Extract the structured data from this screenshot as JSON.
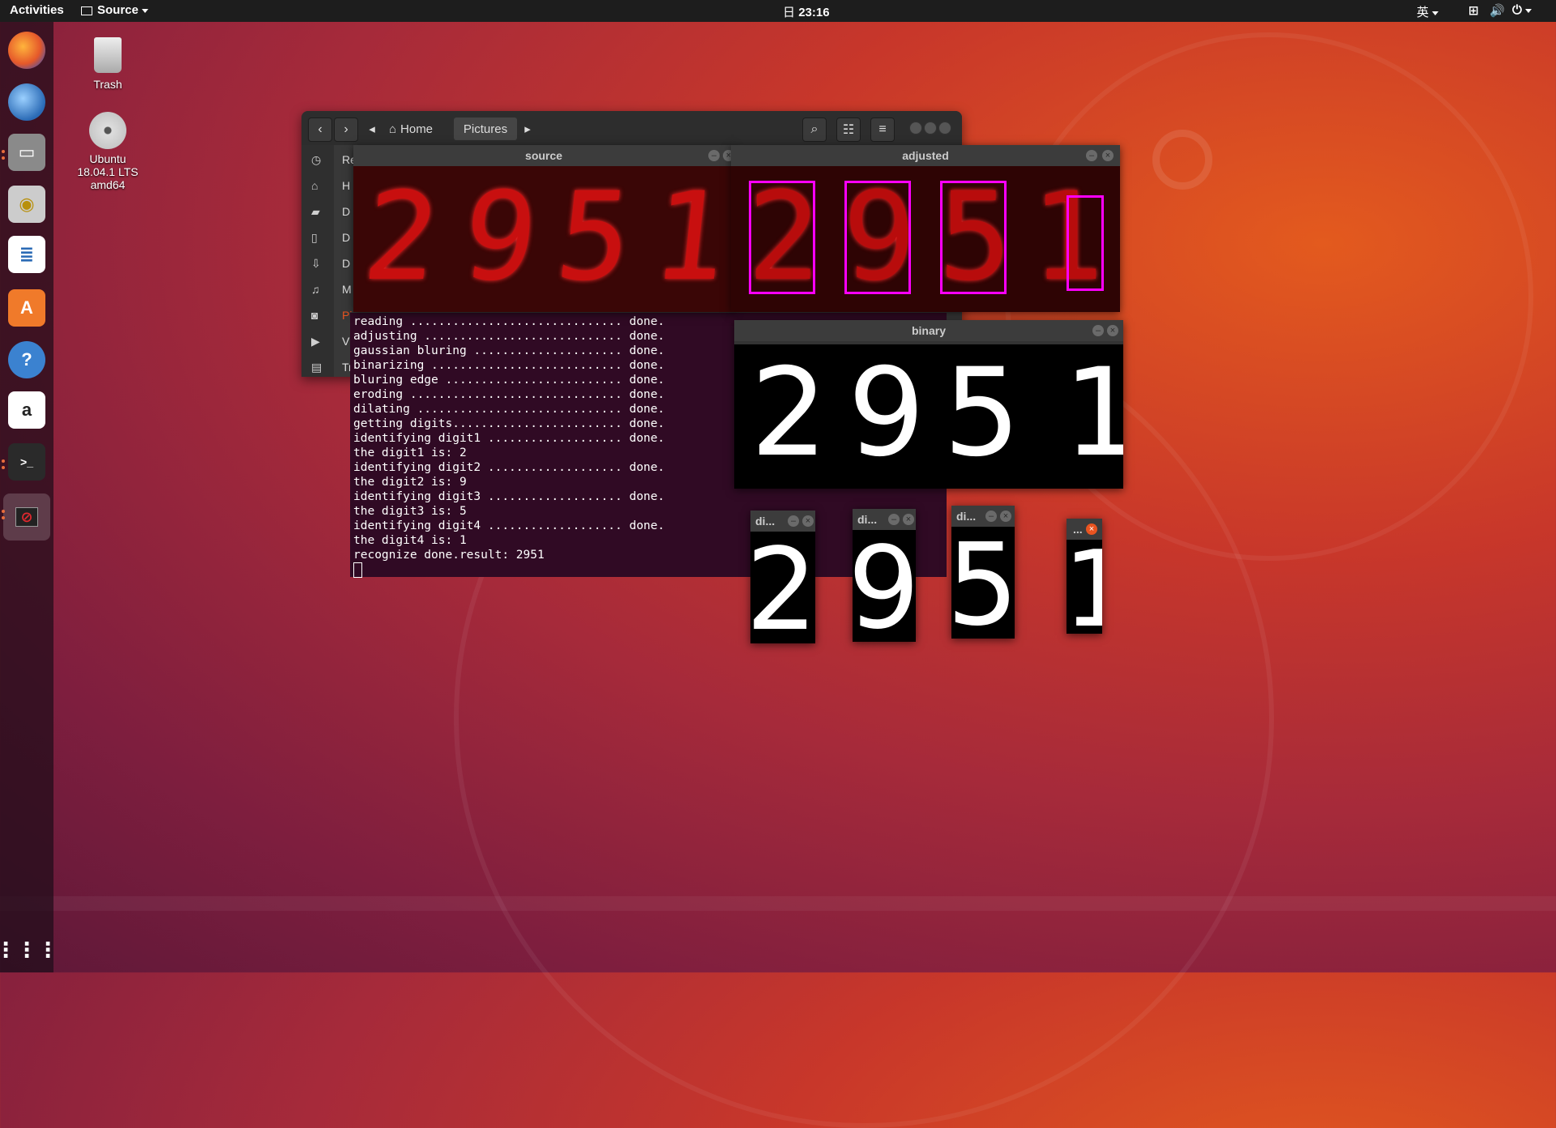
{
  "topbar": {
    "activities": "Activities",
    "app_menu": "Source",
    "clock": "23:16",
    "clock_prefix": "日",
    "input_method": "英"
  },
  "desktop": {
    "trash_label": "Trash",
    "dvd_label_line1": "Ubuntu",
    "dvd_label_line2": "18.04.1 LTS",
    "dvd_label_line3": "amd64"
  },
  "dock": {
    "items": [
      "firefox-icon",
      "thunderbird-icon",
      "files-icon",
      "rhythmbox-icon",
      "writer-icon",
      "software-icon",
      "help-icon",
      "amazon-icon",
      "terminal-icon",
      "blocked-app-icon",
      "app-grid-icon"
    ]
  },
  "file_manager": {
    "crumb_home": "Home",
    "crumb_pictures": "Pictures",
    "sidebar": [
      "Re",
      "H",
      "D",
      "D",
      "D",
      "M",
      "Pi",
      "Vi",
      "Tr"
    ]
  },
  "windows": {
    "source_title": "source",
    "adjusted_title": "adjusted",
    "binary_title": "binary",
    "digit_titles": [
      "di...",
      "di...",
      "di...",
      "..."
    ],
    "digits": [
      "2",
      "9",
      "5",
      "1"
    ]
  },
  "terminal": {
    "lines": [
      "reading .............................. done.",
      "adjusting ............................ done.",
      "gaussian bluring ..................... done.",
      "binarizing ........................... done.",
      "bluring edge ......................... done.",
      "eroding .............................. done.",
      "dilating ............................. done.",
      "getting digits........................ done.",
      "identifying digit1 ................... done.",
      "the digit1 is: 2",
      "identifying digit2 ................... done.",
      "the digit2 is: 9",
      "identifying digit3 ................... done.",
      "the digit3 is: 5",
      "identifying digit4 ................... done.",
      "the digit4 is: 1",
      "recognize done.result: 2951"
    ]
  },
  "colors": {
    "topbar": "#1d1d1d",
    "terminal_bg": "#300a24",
    "accent": "#e95420",
    "bbox": "#ff00ff"
  }
}
